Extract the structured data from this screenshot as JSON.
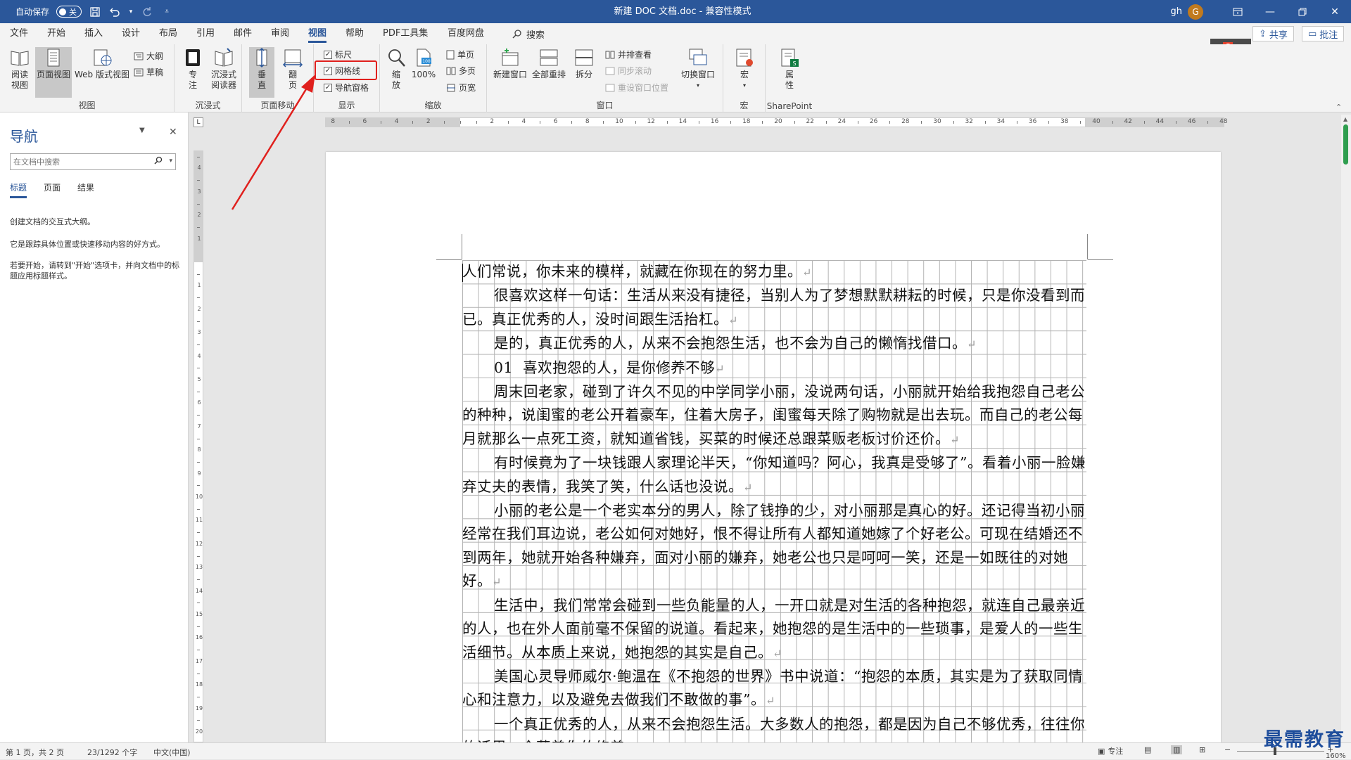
{
  "titlebar": {
    "autosave_label": "自动保存",
    "autosave_state": "关",
    "doc_title": "新建 DOC 文档.doc  -  兼容性模式",
    "user_name": "gh",
    "user_initial": "G"
  },
  "menu": {
    "tabs": [
      "文件",
      "开始",
      "插入",
      "设计",
      "布局",
      "引用",
      "邮件",
      "审阅",
      "视图",
      "帮助",
      "PDF工具集",
      "百度网盘"
    ],
    "active_tab": "视图",
    "search_label": "搜索",
    "share_label": "共享",
    "comment_label": "批注"
  },
  "ribbon": {
    "views": {
      "read_label": "阅读\n视图",
      "print_label": "页面视图",
      "web_label": "Web 版式视图",
      "outline_label": "大纲",
      "draft_label": "草稿",
      "group_label": "视图"
    },
    "immersive": {
      "focus_label": "专\n注",
      "reader_label": "沉浸式\n阅读器",
      "group_label": "沉浸式"
    },
    "page_move": {
      "vertical_label": "垂\n直",
      "side_label": "翻\n页",
      "group_label": "页面移动"
    },
    "show": {
      "ruler_label": "标尺",
      "gridlines_label": "网格线",
      "navpane_label": "导航窗格",
      "ruler_checked": true,
      "gridlines_checked": true,
      "navpane_checked": true,
      "group_label": "显示"
    },
    "zoom": {
      "zoom_label": "缩\n放",
      "hundred_label": "100%",
      "one_page_label": "单页",
      "multi_page_label": "多页",
      "page_width_label": "页宽",
      "group_label": "缩放"
    },
    "window": {
      "new_window_label": "新建窗口",
      "arrange_all_label": "全部重排",
      "split_label": "拆分",
      "side_by_side_label": "并排查看",
      "sync_scroll_label": "同步滚动",
      "reset_pos_label": "重设窗口位置",
      "switch_label": "切换窗口",
      "group_label": "窗口"
    },
    "macros": {
      "macro_label": "宏",
      "group_label": "宏"
    },
    "sharepoint": {
      "properties_label": "属\n性",
      "group_label": "SharePoint"
    }
  },
  "nav": {
    "title": "导航",
    "search_placeholder": "在文档中搜索",
    "tabs": [
      "标题",
      "页面",
      "结果"
    ],
    "active_tab": "标题",
    "msg1": "创建文档的交互式大纲。",
    "msg2": "它是跟踪具体位置或快速移动内容的好方式。",
    "msg3": "若要开始，请转到\"开始\"选项卡，并向文档中的标题应用标题样式。"
  },
  "ruler": {
    "h_numbers": [
      "8",
      "6",
      "4",
      "2",
      "2",
      "4",
      "6",
      "8",
      "10",
      "12",
      "14",
      "16",
      "18",
      "20",
      "22",
      "24",
      "26",
      "28",
      "30",
      "32",
      "34",
      "36",
      "38",
      "40",
      "42",
      "44",
      "46",
      "48"
    ],
    "v_numbers": [
      "4",
      "3",
      "2",
      "1",
      "1",
      "2",
      "3",
      "4",
      "5",
      "6",
      "7",
      "8",
      "9",
      "10",
      "11",
      "12",
      "13",
      "14",
      "15",
      "16",
      "17",
      "18",
      "19",
      "20"
    ]
  },
  "document": {
    "paragraphs": [
      {
        "text": "人们常说，你未来的模样，就藏在你现在的努力里。",
        "indent": false
      },
      {
        "text": "很喜欢这样一句话：生活从来没有捷径，当别人为了梦想默默耕耘的时候，只是你没看到而已。真正优秀的人，没时间跟生活抬杠。",
        "indent": true
      },
      {
        "text": "是的，真正优秀的人，从来不会抱怨生活，也不会为自己的懒惰找借口。",
        "indent": true
      },
      {
        "text": "01  喜欢抱怨的人，是你修养不够",
        "indent": true
      },
      {
        "text": "周末回老家，碰到了许久不见的中学同学小丽，没说两句话，小丽就开始给我抱怨自己老公的种种，说闺蜜的老公开着豪车，住着大房子，闺蜜每天除了购物就是出去玩。而自己的老公每月就那么一点死工资，就知道省钱，买菜的时候还总跟菜贩老板讨价还价。",
        "indent": true
      },
      {
        "text": "有时候竟为了一块钱跟人家理论半天，“你知道吗？阿心，我真是受够了”。看着小丽一脸嫌弃丈夫的表情，我笑了笑，什么话也没说。",
        "indent": true
      },
      {
        "text": "小丽的老公是一个老实本分的男人，除了钱挣的少，对小丽那是真心的好。还记得当初小丽经常在我们耳边说，老公如何对她好，恨不得让所有人都知道她嫁了个好老公。可现在结婚还不到两年，她就开始各种嫌弃，面对小丽的嫌弃，她老公也只是呵呵一笑，还是一如既往的对她好。",
        "indent": true
      },
      {
        "text": "生活中，我们常常会碰到一些负能量的人，一开口就是对生活的各种抱怨，就连自己最亲近的人，也在外人面前毫不保留的说道。看起来，她抱怨的是生活中的一些琐事，是爱人的一些生活细节。从本质上来说，她抱怨的其实是自己。",
        "indent": true
      },
      {
        "text": "美国心灵导师威尔·鲍温在《不抱怨的世界》书中说道：“抱怨的本质，其实是为了获取同情心和注意力，以及避免去做我们不敢做的事”。",
        "indent": true
      },
      {
        "text": "一个真正优秀的人，从来不会抱怨生活。大多数人的抱怨，都是因为自己不够优秀，往往你的话里，全藏着你的修养。",
        "indent": true
      }
    ],
    "para_mark": "↵"
  },
  "status": {
    "page_info": "第 1 页，共 2 页",
    "word_count": "23/1292 个字",
    "language": "中文(中国)",
    "focus_label": "专注",
    "zoom_level": "160%"
  },
  "watermark": "最需教育",
  "colors": {
    "accent": "#2b579a",
    "highlight_box": "#e0201d",
    "gridline": "#b3b3b3",
    "scroll_thumb": "#2f9e4f"
  }
}
